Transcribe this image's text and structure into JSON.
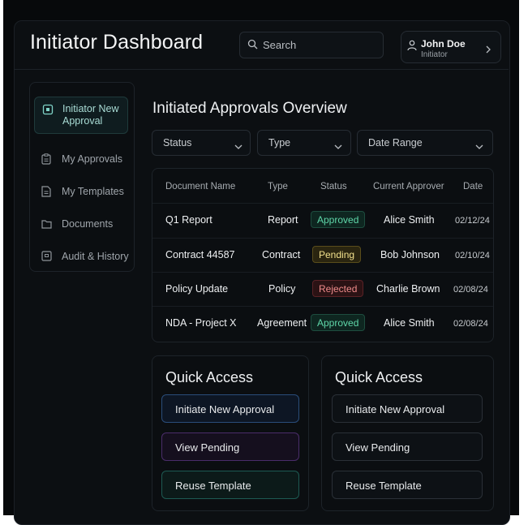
{
  "header": {
    "title": "Initiator Dashboard",
    "search_placeholder": "Search",
    "user_name": "John Doe",
    "user_role": "Initiator"
  },
  "sidebar": {
    "items": [
      {
        "label": "Initiator New Approval",
        "icon": "square-icon",
        "active": true
      },
      {
        "label": "My Approvals",
        "icon": "clipboard-icon"
      },
      {
        "label": "My Templates",
        "icon": "document-icon"
      },
      {
        "label": "Documents",
        "icon": "folder-icon"
      },
      {
        "label": "Audit & History",
        "icon": "archive-icon"
      }
    ]
  },
  "main": {
    "section_title": "Initiated Approvals Overview",
    "filters": [
      "Status",
      "Type",
      "Date Range"
    ],
    "table": {
      "columns": [
        "Document Name",
        "Type",
        "Status",
        "Current Approver",
        "Date"
      ],
      "rows": [
        {
          "name": "Q1 Report",
          "type": "Report",
          "status": "Approved",
          "approver": "Alice Smith",
          "date": "02/12/24"
        },
        {
          "name": "Contract 44587",
          "type": "Contract",
          "status": "Pending",
          "approver": "Bob Johnson",
          "date": "02/10/24"
        },
        {
          "name": "Policy Update",
          "type": "Policy",
          "status": "Rejected",
          "approver": "Charlie Brown",
          "date": "02/08/24"
        },
        {
          "name": "NDA - Project X",
          "type": "Agreement",
          "status": "Approved",
          "approver": "Alice Smith",
          "date": "02/08/24"
        }
      ]
    }
  },
  "quick_access": [
    {
      "title": "Quick Access",
      "buttons": [
        "Initiate New Approval",
        "View Pending",
        "Reuse Template"
      ]
    },
    {
      "title": "Quick Access",
      "buttons": [
        "Initiate New Approval",
        "View Pending",
        "Reuse Template"
      ]
    }
  ],
  "colors": {
    "accent_teal": "#5fd7a9",
    "pending": "#f1e08c",
    "rejected": "#ef8b8b",
    "background": "#0c0f12"
  }
}
